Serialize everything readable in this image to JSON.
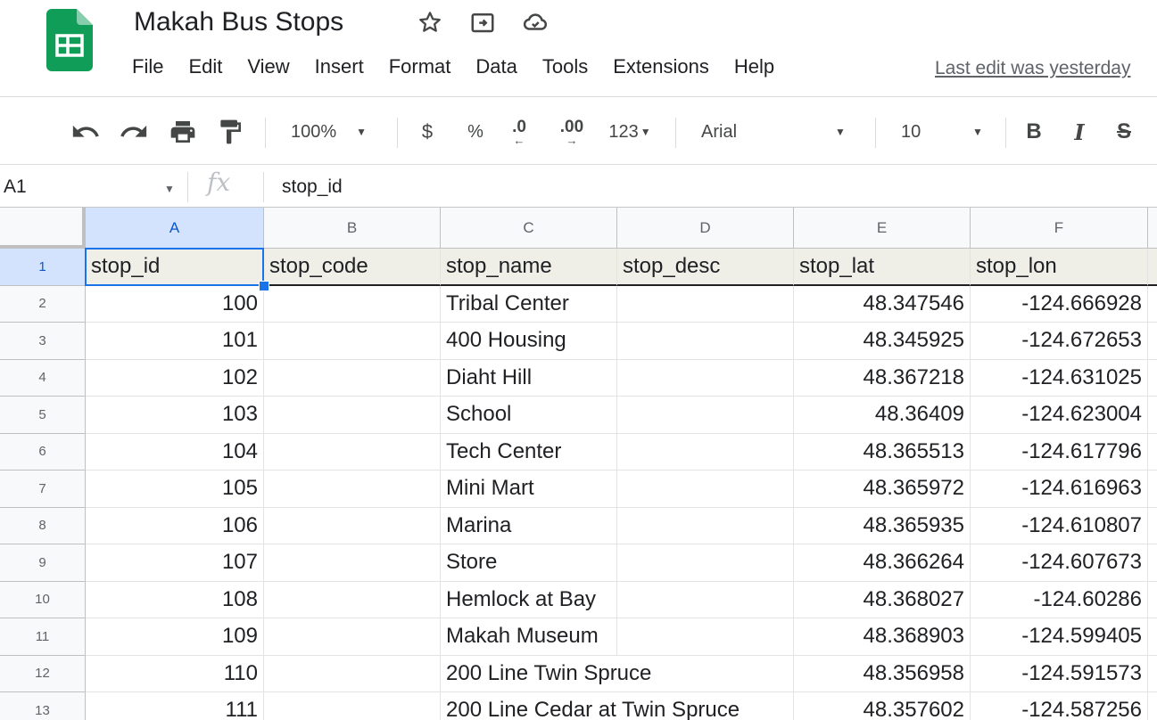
{
  "document": {
    "title": "Makah Bus Stops"
  },
  "menu": [
    "File",
    "Edit",
    "View",
    "Insert",
    "Format",
    "Data",
    "Tools",
    "Extensions",
    "Help"
  ],
  "last_edit": "Last edit was yesterday",
  "toolbar": {
    "zoom": "100%",
    "currency": "$",
    "percent": "%",
    "decimal_decrease": ".0",
    "decimal_increase": ".00",
    "more_formats": "123",
    "font": "Arial",
    "font_size": "10",
    "bold": "B",
    "italic": "I",
    "strike": "S"
  },
  "formula_bar": {
    "cell_ref": "A1",
    "fx": "fx",
    "value": "stop_id"
  },
  "grid": {
    "columns": [
      "A",
      "B",
      "C",
      "D",
      "E",
      "F"
    ],
    "header": [
      "stop_id",
      "stop_code",
      "stop_name",
      "stop_desc",
      "stop_lat",
      "stop_lon"
    ],
    "rows": [
      {
        "n": "2",
        "stop_id": "100",
        "stop_code": "",
        "stop_name": "Tribal Center",
        "stop_desc": "",
        "stop_lat": "48.347546",
        "stop_lon": "-124.666928"
      },
      {
        "n": "3",
        "stop_id": "101",
        "stop_code": "",
        "stop_name": "400 Housing",
        "stop_desc": "",
        "stop_lat": "48.345925",
        "stop_lon": "-124.672653"
      },
      {
        "n": "4",
        "stop_id": "102",
        "stop_code": "",
        "stop_name": "Diaht Hill",
        "stop_desc": "",
        "stop_lat": "48.367218",
        "stop_lon": "-124.631025"
      },
      {
        "n": "5",
        "stop_id": "103",
        "stop_code": "",
        "stop_name": "School",
        "stop_desc": "",
        "stop_lat": "48.36409",
        "stop_lon": "-124.623004"
      },
      {
        "n": "6",
        "stop_id": "104",
        "stop_code": "",
        "stop_name": "Tech Center",
        "stop_desc": "",
        "stop_lat": "48.365513",
        "stop_lon": "-124.617796"
      },
      {
        "n": "7",
        "stop_id": "105",
        "stop_code": "",
        "stop_name": "Mini Mart",
        "stop_desc": "",
        "stop_lat": "48.365972",
        "stop_lon": "-124.616963"
      },
      {
        "n": "8",
        "stop_id": "106",
        "stop_code": "",
        "stop_name": "Marina",
        "stop_desc": "",
        "stop_lat": "48.365935",
        "stop_lon": "-124.610807"
      },
      {
        "n": "9",
        "stop_id": "107",
        "stop_code": "",
        "stop_name": "Store",
        "stop_desc": "",
        "stop_lat": "48.366264",
        "stop_lon": "-124.607673"
      },
      {
        "n": "10",
        "stop_id": "108",
        "stop_code": "",
        "stop_name": "Hemlock at Bay",
        "stop_desc": "",
        "stop_lat": "48.368027",
        "stop_lon": "-124.60286"
      },
      {
        "n": "11",
        "stop_id": "109",
        "stop_code": "",
        "stop_name": "Makah Museum",
        "stop_desc": "",
        "stop_lat": "48.368903",
        "stop_lon": "-124.599405"
      },
      {
        "n": "12",
        "stop_id": "110",
        "stop_code": "",
        "stop_name": "200 Line Twin Spruce",
        "stop_desc": "",
        "stop_lat": "48.356958",
        "stop_lon": "-124.591573"
      },
      {
        "n": "13",
        "stop_id": "111",
        "stop_code": "",
        "stop_name": "200 Line Cedar at Twin Spruce",
        "stop_desc": "",
        "stop_lat": "48.357602",
        "stop_lon": "-124.587256"
      }
    ]
  },
  "colors": {
    "accent": "#1a73e8",
    "sheets_green": "#0f9d58"
  }
}
